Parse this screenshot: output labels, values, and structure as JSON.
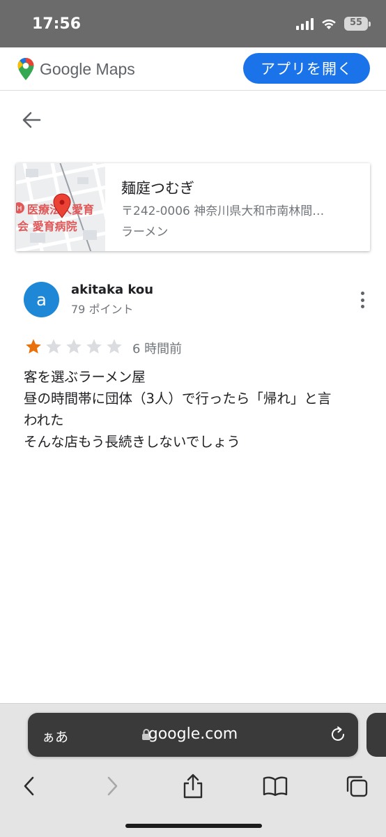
{
  "status_bar": {
    "time": "17:56",
    "battery": "55",
    "icons": [
      "signal-icon",
      "wifi-icon",
      "battery-icon"
    ]
  },
  "header": {
    "brand": "Google Maps",
    "open_app_label": "アプリを開く",
    "accent_color": "#1a73e8"
  },
  "navigation": {
    "back_icon": "arrow-left-icon"
  },
  "place": {
    "name": "麺庭つむぎ",
    "address": "〒242-0006 神奈川県大和市南林間…",
    "category": "ラーメン",
    "map_label_line1": "医療法人愛育",
    "map_label_line2": "会 愛育病院"
  },
  "review": {
    "avatar_letter": "a",
    "avatar_color": "#1e88d7",
    "reviewer_name": "akitaka kou",
    "reviewer_points": "79 ポイント",
    "rating": 1,
    "rating_max": 5,
    "star_color": "#e8710a",
    "time_ago": "6 時間前",
    "text_lines": [
      "客を選ぶラーメン屋",
      "昼の時間帯に団体（3人）で行ったら「帰れ」と言",
      "われた",
      "そんな店もう長続きしないでしょう"
    ]
  },
  "browser": {
    "text_size_label": "ぁあ",
    "url": "google.com",
    "toolbar_icons": [
      "back-icon",
      "forward-icon",
      "share-icon",
      "bookmarks-icon",
      "tabs-icon"
    ]
  }
}
